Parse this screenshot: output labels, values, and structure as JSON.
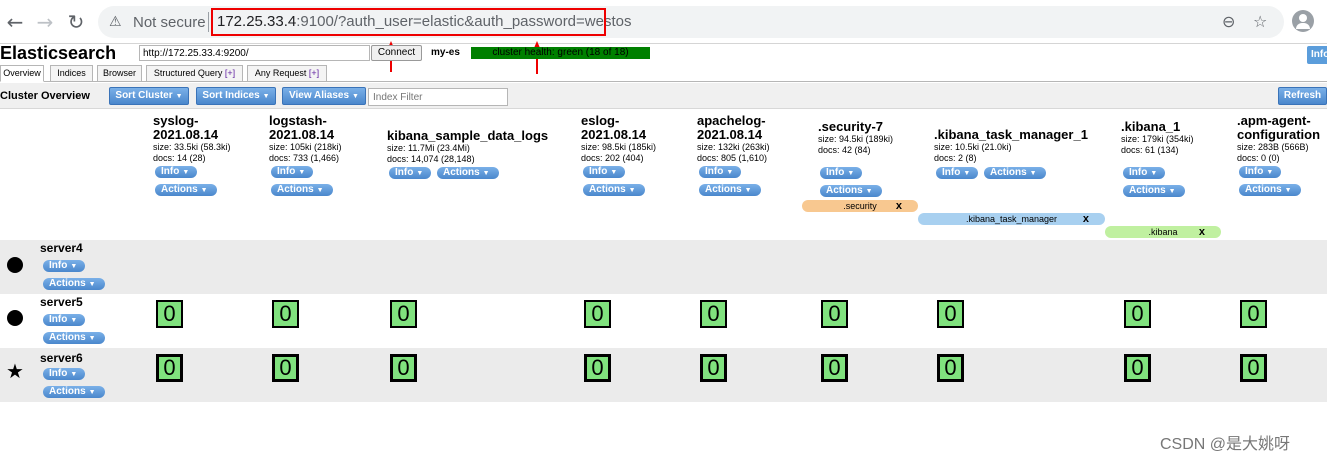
{
  "browser": {
    "not_secure": "Not secure",
    "url_host": "172.25.33.4",
    "url_rest": ":9100/?auth_user=elastic&auth_password=westos"
  },
  "app": {
    "title": "Elasticsearch",
    "host_value": "http://172.25.33.4:9200/",
    "connect_label": "Connect",
    "cluster_name": "my-es",
    "health": "cluster health: green (18 of 18)",
    "info_label": "Info"
  },
  "tabs": [
    {
      "label": "Overview"
    },
    {
      "label": "Indices"
    },
    {
      "label": "Browser"
    },
    {
      "label": "Structured Query",
      "plus": "[+]"
    },
    {
      "label": "Any Request",
      "plus": "[+]"
    }
  ],
  "toolbar": {
    "title": "Cluster Overview",
    "sort_cluster": "Sort Cluster",
    "sort_indices": "Sort Indices",
    "view_aliases": "View Aliases",
    "filter_placeholder": "Index Filter",
    "refresh": "Refresh"
  },
  "pill_labels": {
    "info": "Info",
    "actions": "Actions"
  },
  "indices": [
    {
      "name": "syslog-\n2021.08.14",
      "size": "size: 33.5ki (58.3ki)",
      "docs": "docs: 14 (28)"
    },
    {
      "name": "logstash-\n2021.08.14",
      "size": "size: 105ki (218ki)",
      "docs": "docs: 733 (1,466)"
    },
    {
      "name": "kibana_sample_data_logs",
      "size": "size: 11.7Mi (23.4Mi)",
      "docs": "docs: 14,074 (28,148)"
    },
    {
      "name": "eslog-\n2021.08.14",
      "size": "size: 98.5ki (185ki)",
      "docs": "docs: 202 (404)"
    },
    {
      "name": "apachelog-\n2021.08.14",
      "size": "size: 132ki (263ki)",
      "docs": "docs: 805 (1,610)"
    },
    {
      "name": ".security-7",
      "size": "size: 94.5ki (189ki)",
      "docs": "docs: 42 (84)"
    },
    {
      "name": ".kibana_task_manager_1",
      "size": "size: 10.5ki (21.0ki)",
      "docs": "docs: 2 (8)"
    },
    {
      "name": ".kibana_1",
      "size": "size: 179ki (354ki)",
      "docs": "docs: 61 (134)"
    },
    {
      "name": ".apm-agent-\nconfiguration",
      "size": "size: 283B (566B)",
      "docs": "docs: 0 (0)"
    }
  ],
  "aliases": [
    {
      "name": ".security",
      "close": "x",
      "color": "#f8c890"
    },
    {
      "name": ".kibana_task_manager",
      "close": "x",
      "color": "#a8d0f0"
    },
    {
      "name": ".kibana",
      "close": "x",
      "color": "#c0f0a0"
    }
  ],
  "nodes": [
    {
      "name": "server4",
      "icon": "circle"
    },
    {
      "name": "server5",
      "icon": "circle"
    },
    {
      "name": "server6",
      "icon": "star"
    }
  ],
  "shard_label": "0",
  "watermark": "CSDN @是大姚呀"
}
